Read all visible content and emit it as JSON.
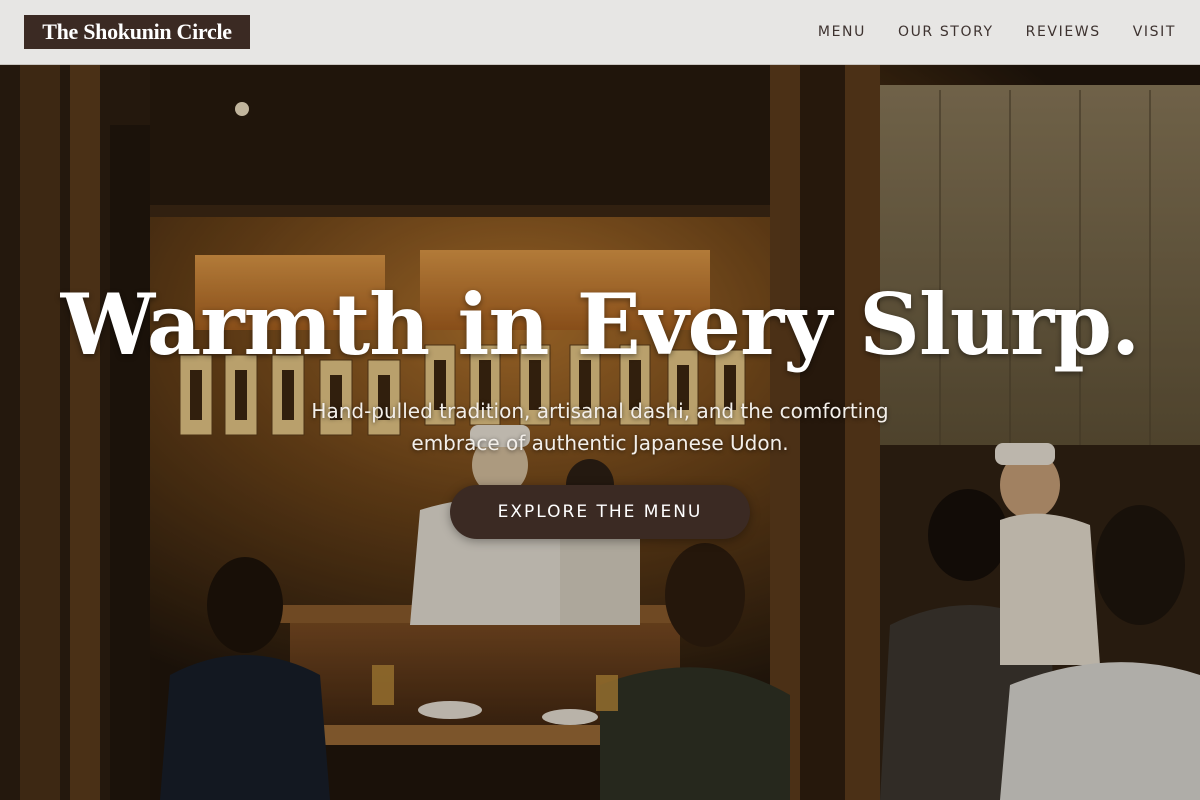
{
  "header": {
    "brand": "The Shokunin Circle",
    "nav": [
      {
        "label": "MENU"
      },
      {
        "label": "OUR STORY"
      },
      {
        "label": "REVIEWS"
      },
      {
        "label": "VISIT"
      }
    ]
  },
  "hero": {
    "headline": "Warmth in Every Slurp.",
    "tagline": "Hand-pulled tradition, artisanal dashi, and the comforting embrace of authentic Japanese Udon.",
    "cta_label": "EXPLORE THE MENU",
    "background_image": "izakaya-restaurant-interior-photo"
  },
  "colors": {
    "header_bg": "#e7e6e4",
    "brand_bg": "#3b2a23",
    "accent": "#3b2a23",
    "nav_text": "#3e3330",
    "headline_text": "#ffffff"
  }
}
